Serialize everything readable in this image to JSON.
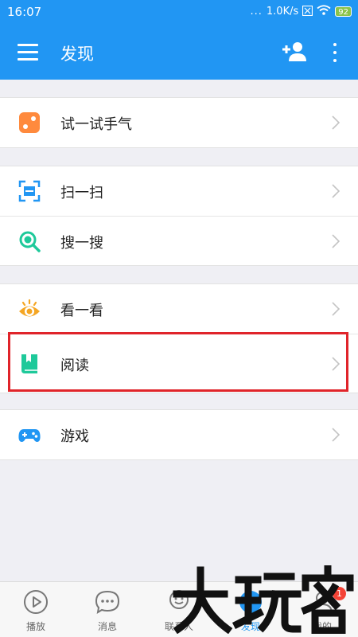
{
  "status_bar": {
    "time": "16:07",
    "dots": "...",
    "network_speed": "1.0K/s",
    "battery": "92"
  },
  "app_bar": {
    "title": "发现"
  },
  "groups": [
    {
      "items": [
        {
          "label": "试一试手气",
          "icon": "dice-icon"
        }
      ]
    },
    {
      "items": [
        {
          "label": "扫一扫",
          "icon": "scan-icon"
        },
        {
          "label": "搜一搜",
          "icon": "search-icon"
        }
      ]
    },
    {
      "items": [
        {
          "label": "看一看",
          "icon": "eye-icon"
        },
        {
          "label": "阅读",
          "icon": "book-icon"
        }
      ]
    },
    {
      "items": [
        {
          "label": "游戏",
          "icon": "gamepad-icon"
        }
      ]
    }
  ],
  "tabs": [
    {
      "label": "播放",
      "icon": "play-icon"
    },
    {
      "label": "消息",
      "icon": "chat-icon"
    },
    {
      "label": "联系人",
      "icon": "contacts-icon"
    },
    {
      "label": "发现",
      "icon": "discover-icon",
      "active": true
    },
    {
      "label": "我的",
      "icon": "profile-icon",
      "badge": "1"
    }
  ],
  "colors": {
    "primary": "#2196f3",
    "highlight": "#e0242a",
    "dice": "#ff8a3d",
    "teal": "#1ec99a",
    "eye": "#f5a623",
    "badge": "#f44336"
  }
}
